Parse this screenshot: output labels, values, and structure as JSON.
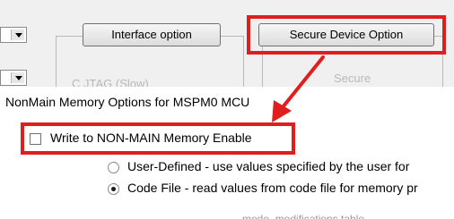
{
  "upper_panel": {
    "interface_button_label": "Interface option",
    "secure_button_label": "Secure Device Option",
    "ghost_left_text": "C JTAG (Slow)",
    "ghost_right_text": "Secure"
  },
  "nonmain": {
    "heading": "NonMain Memory Options for MSPM0 MCU",
    "write_checkbox_label": "Write to NON-MAIN Memory Enable",
    "write_checkbox_checked": false,
    "options": [
      {
        "label": "User-Defined - use values specified by the user for",
        "selected": false
      },
      {
        "label": "Code File - read values from code file for memory pr",
        "selected": true
      }
    ],
    "bottom_cut_text": "...mode, modifications table..."
  },
  "colors": {
    "highlight": "#e01e1e",
    "panel_bg": "#f0f0f0"
  }
}
